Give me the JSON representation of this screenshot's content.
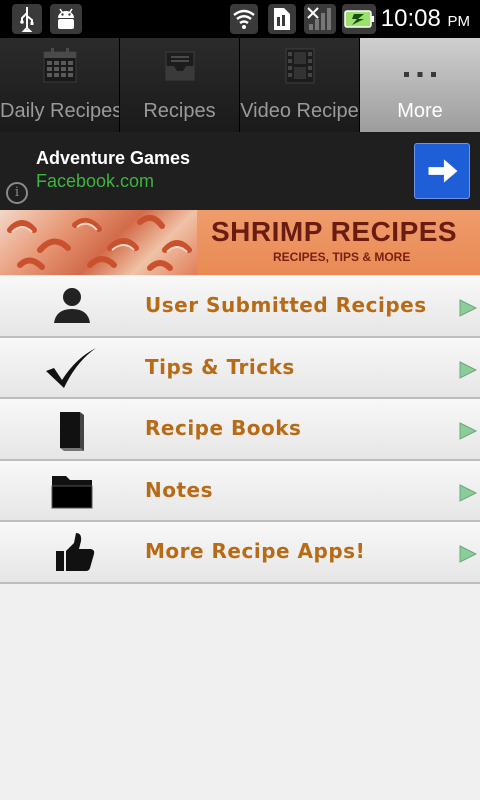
{
  "status_bar": {
    "time": "10:08",
    "ampm": "PM",
    "icons": [
      "usb-icon",
      "android-debug-icon",
      "wifi-icon",
      "sim-icon",
      "signal-icon",
      "battery-charging-icon"
    ]
  },
  "tabs": [
    {
      "label": "Daily Recipes",
      "icon": "calendar-icon",
      "active": false
    },
    {
      "label": "Recipes",
      "icon": "inbox-tray-icon",
      "active": false
    },
    {
      "label": "Video Recipe",
      "icon": "film-strip-icon",
      "active": false
    },
    {
      "label": "More",
      "icon": "more-dots-icon",
      "active": true
    }
  ],
  "ad": {
    "title": "Adventure Games",
    "subtitle": "Facebook.com",
    "info_glyph": "i",
    "cta_icon": "arrow-right-icon"
  },
  "header": {
    "title": "SHRIMP RECIPES",
    "subtitle": "RECIPES, TIPS & MORE"
  },
  "menu": {
    "items": [
      {
        "label": "User Submitted Recipes",
        "icon": "person-icon"
      },
      {
        "label": "Tips & Tricks",
        "icon": "checkmark-icon"
      },
      {
        "label": "Recipe Books",
        "icon": "book-icon"
      },
      {
        "label": "Notes",
        "icon": "folder-icon"
      },
      {
        "label": "More Recipe Apps!",
        "icon": "thumbs-up-icon"
      }
    ]
  },
  "colors": {
    "menu_label": "#b86b17",
    "ad_subtitle": "#3fb33f",
    "ad_button": "#1e5fd8",
    "arrow": "#8ccb9a"
  }
}
